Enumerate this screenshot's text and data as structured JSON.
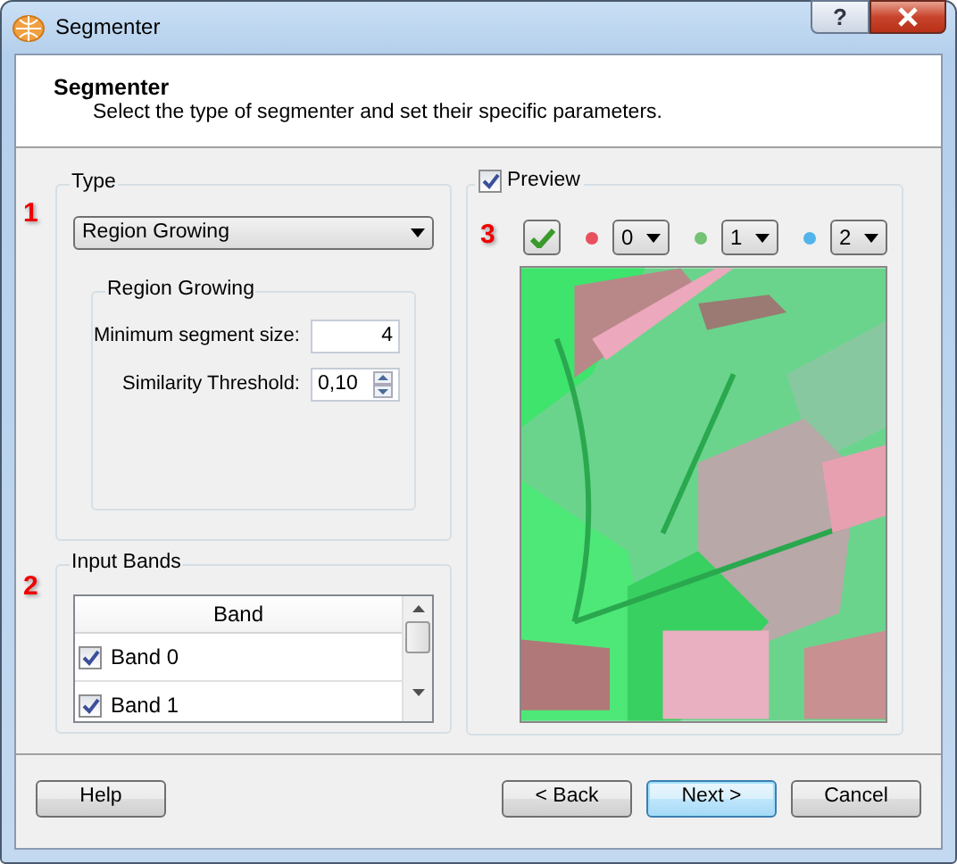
{
  "window": {
    "title": "Segmenter",
    "help_button": "?"
  },
  "header": {
    "title": "Segmenter",
    "subtitle": "Select the type of segmenter and set their specific parameters."
  },
  "type_group": {
    "marker": "1",
    "legend": "Type",
    "segmenter_type": "Region Growing",
    "parameters": {
      "legend": "Region Growing",
      "fields": [
        {
          "kind": "text",
          "label": "Minimum segment size:",
          "value": "4"
        },
        {
          "kind": "spin",
          "label": "Similarity Threshold:",
          "value": "0,10"
        }
      ]
    }
  },
  "input_bands": {
    "marker": "2",
    "legend": "Input Bands",
    "column": "Band",
    "rows": [
      {
        "label": "Band 0",
        "checked": true
      },
      {
        "label": "Band 1",
        "checked": true
      }
    ]
  },
  "preview": {
    "marker": "3",
    "label": "Preview",
    "checked": true,
    "channels": [
      {
        "color": "#e8505e",
        "band": "0"
      },
      {
        "color": "#74c274",
        "band": "1"
      },
      {
        "color": "#52b4ea",
        "band": "2"
      }
    ]
  },
  "left_buttons": [
    {
      "label": "Help",
      "default": false
    }
  ],
  "right_buttons": [
    {
      "label": "< Back",
      "default": false
    },
    {
      "label": "Next >",
      "default": true
    },
    {
      "label": "Cancel",
      "default": false
    }
  ]
}
